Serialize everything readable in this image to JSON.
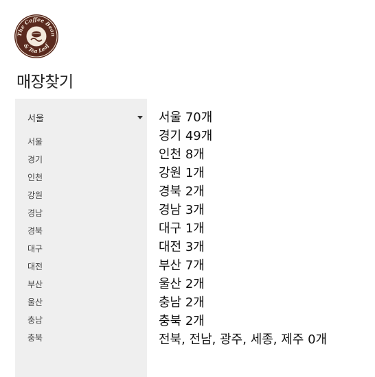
{
  "logo": {
    "top_text": "The Coffee Bean",
    "bottom_text": "& Tea Leaf",
    "ring_color": "#5a2a1e"
  },
  "page_title": "매장찾기",
  "region_select": {
    "selected": "서울"
  },
  "region_options": [
    "서울",
    "경기",
    "인천",
    "강원",
    "경남",
    "경북",
    "대구",
    "대전",
    "부산",
    "울산",
    "충남",
    "충북"
  ],
  "store_counts": [
    "서울 70개",
    "경기 49개",
    "인천 8개",
    "강원 1개",
    "경북 2개",
    "경남 3개",
    "대구 1개",
    "대전 3개",
    "부산 7개",
    "울산 2개",
    "충남 2개",
    "충북 2개",
    "전북, 전남, 광주, 세종, 제주  0개"
  ],
  "colors": {
    "panel_bg": "#efefef",
    "text": "#222222"
  }
}
